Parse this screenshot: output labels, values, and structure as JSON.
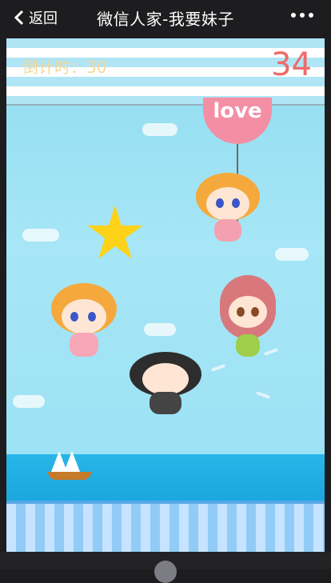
{
  "nav": {
    "back_label": "返回",
    "title": "微信人家-我要妹子",
    "more_icon": "more-dots-icon",
    "back_icon": "chevron-left-icon"
  },
  "game": {
    "countdown_label": "倒计时：30",
    "score": "34",
    "balloon_label": "love"
  },
  "colors": {
    "score": "#ef6a6a",
    "countdown": "#f4d79a",
    "balloon": "#f48ea4"
  }
}
